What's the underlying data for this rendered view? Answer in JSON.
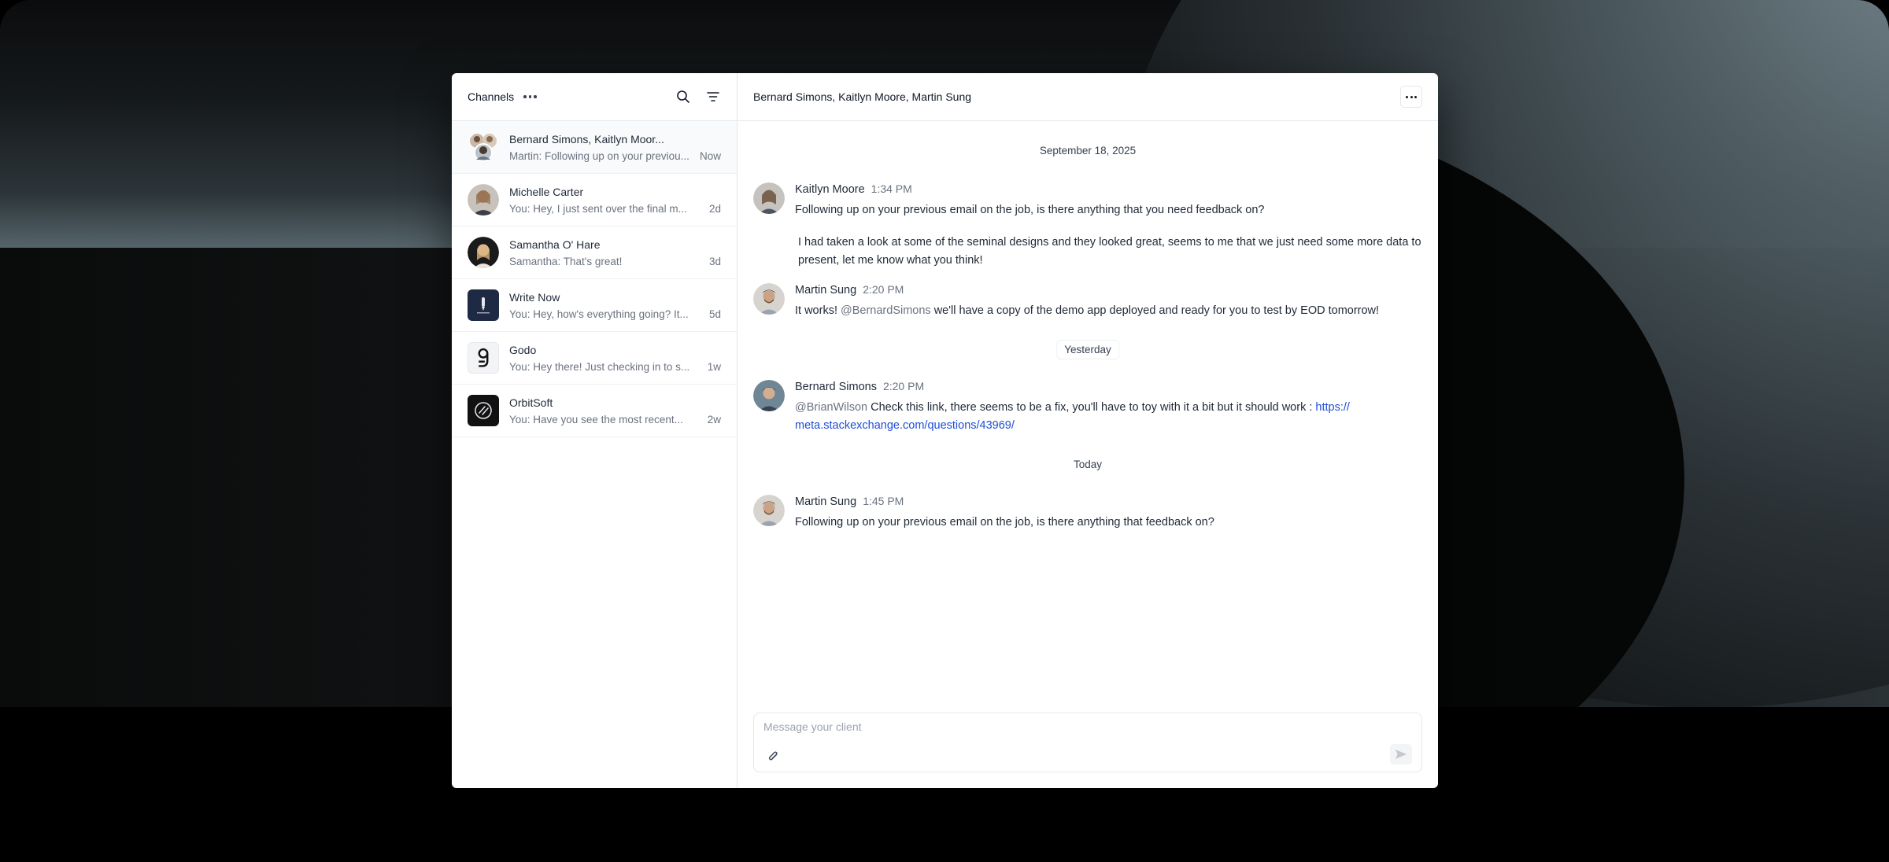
{
  "sidebar": {
    "title": "Channels",
    "channels": [
      {
        "name": "Bernard Simons, Kaitlyn Moor...",
        "preview": "Martin: Following up on your previou...",
        "time": "Now"
      },
      {
        "name": "Michelle Carter",
        "preview": "You: Hey, I just sent over the final m...",
        "time": "2d"
      },
      {
        "name": "Samantha O' Hare",
        "preview": "Samantha: That's great!",
        "time": "3d"
      },
      {
        "name": "Write Now",
        "preview": "You: Hey, how's everything going? It...",
        "time": "5d"
      },
      {
        "name": "Godo",
        "preview": "You: Hey there! Just checking in to s...",
        "time": "1w"
      },
      {
        "name": "OrbitSoft",
        "preview": "You: Have you see the most recent...",
        "time": "2w"
      }
    ]
  },
  "header": {
    "title": "Bernard Simons, Kaitlyn Moore, Martin Sung"
  },
  "dates": {
    "first": "September 18, 2025",
    "yesterday": "Yesterday",
    "today": "Today"
  },
  "messages": [
    {
      "author": "Kaitlyn Moore",
      "time": "1:34 PM",
      "text1": "Following up on your previous email on the job, is there anything that you need feedback on?",
      "text2": "I had taken a look at some of the seminal designs and they looked great, seems to me that we just need some more data to present, let me know what you think!"
    },
    {
      "author": "Martin Sung",
      "time": "2:20 PM",
      "pre": "It works! ",
      "mention": "@BernardSimons",
      "post": " we'll have a copy of the demo app deployed and ready for you to test by EOD tomorrow!"
    },
    {
      "author": "Bernard Simons",
      "time": "2:20 PM",
      "mention": "@BrianWilson",
      "post": " Check this link, there seems to be a fix, you'll have to toy with it a bit but it should work : ",
      "link1": "https://",
      "link2": "meta.stackexchange.com/questions/43969/"
    },
    {
      "author": "Martin Sung",
      "time": "1:45 PM",
      "text": "Following up on your previous email on the job, is there anything that feedback on?"
    }
  ],
  "composer": {
    "placeholder": "Message your client"
  },
  "colors": {
    "link": "#1d4ed8",
    "muted": "#6b7280",
    "border": "#e5e7eb"
  }
}
